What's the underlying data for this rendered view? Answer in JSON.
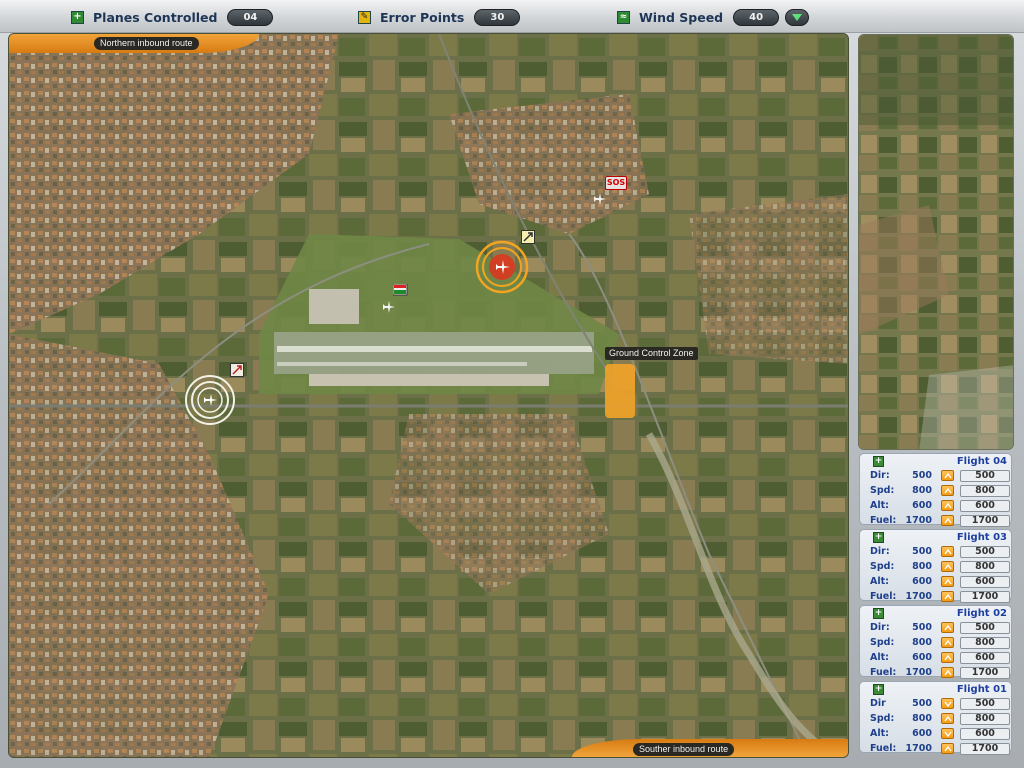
{
  "hud": {
    "planes_controlled": {
      "label": "Planes Controlled",
      "value": "04",
      "icon": "plus-icon"
    },
    "error_points": {
      "label": "Error Points",
      "value": "30",
      "icon": "warning-icon"
    },
    "wind_speed": {
      "label": "Wind Speed",
      "value": "40",
      "icon": "wind-icon"
    }
  },
  "map": {
    "northern_route_label": "Northern inbound route",
    "southern_route_label": "Souther inbound route",
    "ground_control_label": "Ground Control Zone",
    "sos_label": "SOS"
  },
  "flights": [
    {
      "name": "Flight 04",
      "fields": [
        {
          "label": "Dir:",
          "current": "500",
          "target": "500",
          "arrow": "up"
        },
        {
          "label": "Spd:",
          "current": "800",
          "target": "800",
          "arrow": "up"
        },
        {
          "label": "Alt:",
          "current": "600",
          "target": "600",
          "arrow": "up"
        },
        {
          "label": "Fuel:",
          "current": "1700",
          "target": "1700",
          "arrow": "up"
        }
      ]
    },
    {
      "name": "Flight 03",
      "fields": [
        {
          "label": "Dir:",
          "current": "500",
          "target": "500",
          "arrow": "up"
        },
        {
          "label": "Spd:",
          "current": "800",
          "target": "800",
          "arrow": "up"
        },
        {
          "label": "Alt:",
          "current": "600",
          "target": "600",
          "arrow": "up"
        },
        {
          "label": "Fuel:",
          "current": "1700",
          "target": "1700",
          "arrow": "up"
        }
      ]
    },
    {
      "name": "Flight 02",
      "fields": [
        {
          "label": "Dir:",
          "current": "500",
          "target": "500",
          "arrow": "up"
        },
        {
          "label": "Spd:",
          "current": "800",
          "target": "800",
          "arrow": "up"
        },
        {
          "label": "Alt:",
          "current": "600",
          "target": "600",
          "arrow": "up"
        },
        {
          "label": "Fuel:",
          "current": "1700",
          "target": "1700",
          "arrow": "up"
        }
      ]
    },
    {
      "name": "Flight 01",
      "fields": [
        {
          "label": "Dir",
          "current": "500",
          "target": "500",
          "arrow": "down"
        },
        {
          "label": "Spd:",
          "current": "800",
          "target": "800",
          "arrow": "up"
        },
        {
          "label": "Alt:",
          "current": "600",
          "target": "600",
          "arrow": "down"
        },
        {
          "label": "Fuel:",
          "current": "1700",
          "target": "1700",
          "arrow": "up"
        }
      ]
    }
  ],
  "colors": {
    "accent_orange": "#f0a43a",
    "label_blue": "#1d3f8c",
    "hud_text": "#1e3556",
    "plus_green": "#3b8b36"
  }
}
